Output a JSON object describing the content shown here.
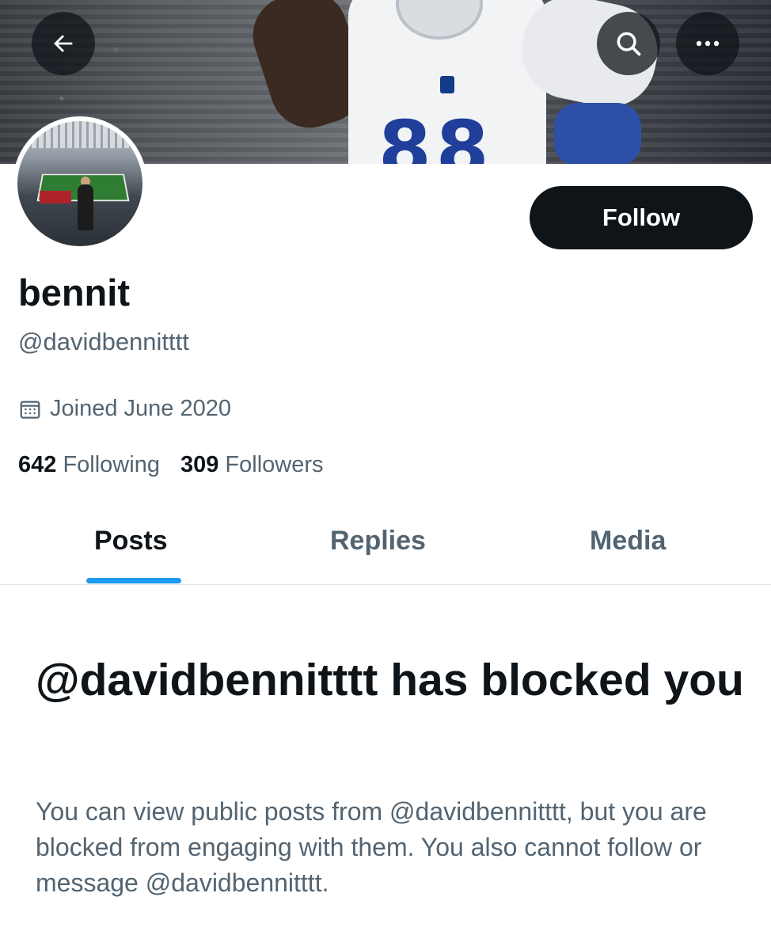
{
  "profile": {
    "display_name": "bennit",
    "handle": "@davidbennitttt",
    "joined": "Joined June 2020"
  },
  "stats": {
    "following_count": "642",
    "following_label": "Following",
    "followers_count": "309",
    "followers_label": "Followers"
  },
  "actions": {
    "follow_label": "Follow"
  },
  "tabs": [
    {
      "label": "Posts",
      "active": true
    },
    {
      "label": "Replies",
      "active": false
    },
    {
      "label": "Media",
      "active": false
    }
  ],
  "blocked": {
    "title": "@davidbennitttt has blocked you",
    "body": "You can view public posts from @davidbennitttt, but you are blocked from engaging with them. You also cannot follow or message @davidbennitttt."
  },
  "banner": {
    "jersey_number": "88"
  },
  "icons": {
    "back": "back-arrow-icon",
    "search": "search-icon",
    "more": "more-icon",
    "calendar": "calendar-icon"
  },
  "colors": {
    "accent": "#1d9bf0",
    "text_primary": "#0f1419",
    "text_secondary": "#536471",
    "button_bg": "#0f1419"
  }
}
